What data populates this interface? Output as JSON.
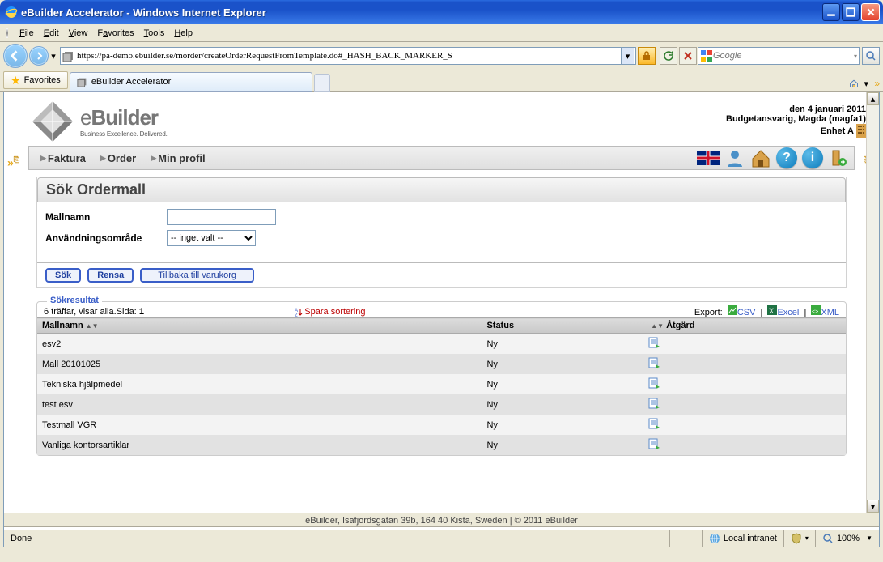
{
  "window": {
    "title": "eBuilder Accelerator - Windows Internet Explorer",
    "menu": {
      "file": "File",
      "edit": "Edit",
      "view": "View",
      "favorites": "Favorites",
      "tools": "Tools",
      "help": "Help"
    },
    "url": "https://pa-demo.ebuilder.se/morder/createOrderRequestFromTemplate.do#_HASH_BACK_MARKER_S",
    "search_placeholder": "Google",
    "favorites_label": "Favorites",
    "tab_label": "eBuilder Accelerator"
  },
  "app": {
    "brand": "eBuilder",
    "brand_tagline": "Business Excellence. Delivered.",
    "date_line": "den 4 januari 2011",
    "user_line": "Budgetansvarig, Magda (magfa1)",
    "unit_line": "Enhet A",
    "nav": {
      "faktura": "Faktura",
      "order": "Order",
      "profil": "Min profil"
    }
  },
  "form": {
    "heading": "Sök Ordermall",
    "label_mallnamn": "Mallnamn",
    "label_anvandning": "Användningsområde",
    "select_default": "-- inget valt --",
    "btn_sok": "Sök",
    "btn_rensa": "Rensa",
    "btn_tillbaka": "Tillbaka till varukorg"
  },
  "results": {
    "legend": "Sökresultat",
    "hits_text": "6 träffar, visar alla.Sida: ",
    "page": "1",
    "sort_save": "Spara sortering",
    "export_label": "Export:",
    "export_csv": "CSV",
    "export_excel": "Excel",
    "export_xml": "XML",
    "col_mallnamn": "Mallnamn",
    "col_status": "Status",
    "col_atgard": "Åtgärd",
    "rows": [
      {
        "name": "esv2",
        "status": "Ny"
      },
      {
        "name": "Mall 20101025",
        "status": "Ny"
      },
      {
        "name": "Tekniska hjälpmedel",
        "status": "Ny"
      },
      {
        "name": "test esv",
        "status": "Ny"
      },
      {
        "name": "Testmall VGR",
        "status": "Ny"
      },
      {
        "name": "Vanliga kontorsartiklar",
        "status": "Ny"
      }
    ]
  },
  "footer_text": "eBuilder, Isafjordsgatan 39b, 164 40 Kista, Sweden | © 2011 eBuilder",
  "status": {
    "done": "Done",
    "zone": "Local intranet",
    "zoom": "100%"
  }
}
